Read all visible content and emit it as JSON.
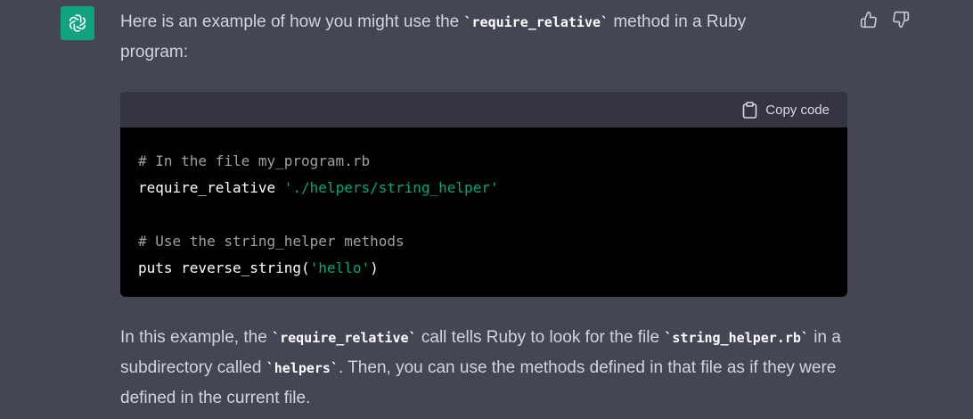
{
  "assistant": {
    "avatar_icon": "openai-logo-icon",
    "brand_color": "#10a37f"
  },
  "feedback": {
    "thumbs_up_icon": "thumbs-up-icon",
    "thumbs_down_icon": "thumbs-down-icon"
  },
  "message": {
    "intro": {
      "pre": "Here is an example of how you might use the ",
      "code": "`require_relative`",
      "post": " method in a Ruby program:"
    },
    "codeblock": {
      "copy_label": "Copy code",
      "copy_icon": "clipboard-icon",
      "lines": {
        "l1_comment": "# In the file my_program.rb",
        "l2_keyword": "require_relative ",
        "l2_string": "'./helpers/string_helper'",
        "l4_comment": "# Use the string_helper methods",
        "l5_call": "puts reverse_string(",
        "l5_string": "'hello'",
        "l5_close": ")"
      },
      "colors": {
        "comment": "#a0a0a0",
        "string": "#00a67d",
        "background": "#000000",
        "header": "#343541"
      }
    },
    "outro": {
      "t1": "In this example, the ",
      "c1": "`require_relative`",
      "t2": " call tells Ruby to look for the file ",
      "c2": "`string_helper.rb`",
      "t3": " in a subdirectory called ",
      "c3": "`helpers`",
      "t4": ". Then, you can use the methods defined in that file as if they were defined in the current file."
    }
  }
}
